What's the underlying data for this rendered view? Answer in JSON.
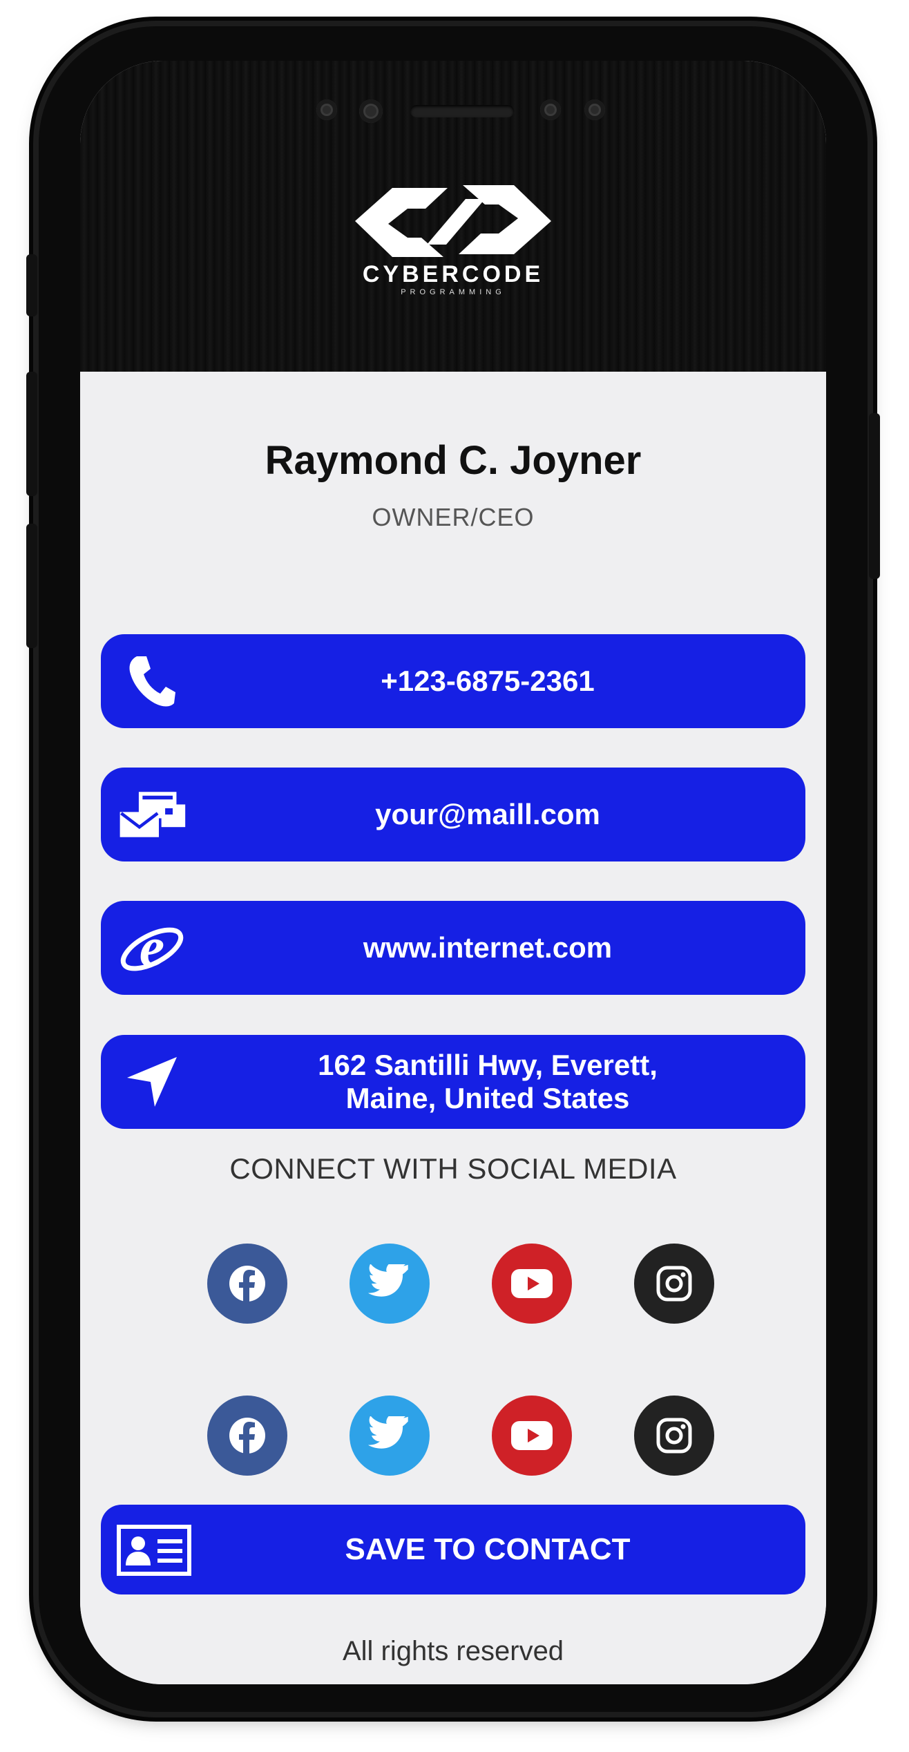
{
  "brand": {
    "name": "CYBERCODE",
    "tagline": "PROGRAMMING"
  },
  "profile": {
    "name": "Raymond C. Joyner",
    "title": "OWNER/CEO"
  },
  "contacts": [
    {
      "icon": "phone-icon",
      "text": "+123-6875-2361"
    },
    {
      "icon": "mail-icon",
      "text": "your@maill.com"
    },
    {
      "icon": "internet-explorer-icon",
      "text": "www.internet.com"
    },
    {
      "icon": "location-arrow-icon",
      "line1": "162 Santilli Hwy, Everett,",
      "line2": "Maine, United States"
    }
  ],
  "social": {
    "heading": "CONNECT WITH SOCIAL MEDIA",
    "rows": [
      [
        "facebook-icon",
        "twitter-icon",
        "youtube-icon",
        "instagram-icon"
      ],
      [
        "facebook-icon",
        "twitter-icon",
        "youtube-icon",
        "instagram-icon"
      ]
    ]
  },
  "save_button": {
    "icon": "contact-card-icon",
    "label": "SAVE TO CONTACT"
  },
  "footer": {
    "text": "All rights reserved"
  },
  "colors": {
    "accent": "#1620e4",
    "facebook": "#3b5998",
    "twitter": "#2ea2e8",
    "youtube": "#cf2127",
    "instagram": "#222222",
    "background": "#efeff1"
  }
}
